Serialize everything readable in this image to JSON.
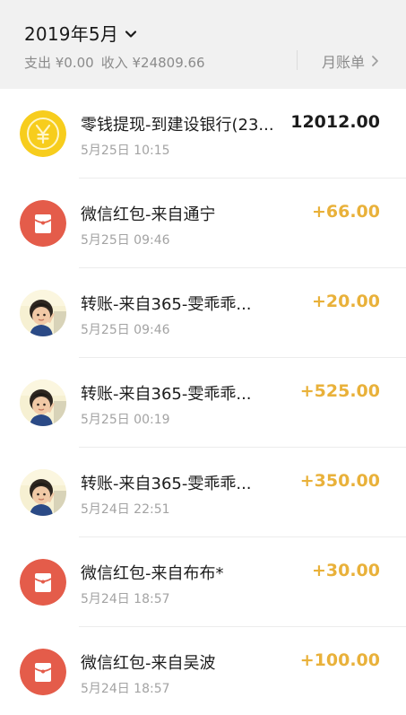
{
  "header": {
    "month": "2019年5月",
    "expense": "支出 ¥0.00",
    "income": "收入 ¥24809.66",
    "bill_link": "月账单"
  },
  "icons": {
    "coin": "yen-coin-icon",
    "red_packet": "red-packet-icon",
    "avatar": "child-avatar-photo"
  },
  "colors": {
    "coin": "#f7cd1d",
    "red_packet": "#e45c4a",
    "income_amount": "#e9b13a"
  },
  "transactions": [
    {
      "title": "零钱提现-到建设银行(23...",
      "time": "5月25日 10:15",
      "amount": "12012.00",
      "icon": "coin",
      "type": "withdrawal"
    },
    {
      "title": "微信红包-来自通宁",
      "time": "5月25日 09:46",
      "amount": "+66.00",
      "icon": "red_packet",
      "type": "income"
    },
    {
      "title": "转账-来自365-雯乖乖...",
      "time": "5月25日 09:46",
      "amount": "+20.00",
      "icon": "avatar",
      "type": "income"
    },
    {
      "title": "转账-来自365-雯乖乖...",
      "time": "5月25日 00:19",
      "amount": "+525.00",
      "icon": "avatar",
      "type": "income"
    },
    {
      "title": "转账-来自365-雯乖乖...",
      "time": "5月24日 22:51",
      "amount": "+350.00",
      "icon": "avatar",
      "type": "income"
    },
    {
      "title": "微信红包-来自布布*",
      "time": "5月24日 18:57",
      "amount": "+30.00",
      "icon": "red_packet",
      "type": "income"
    },
    {
      "title": "微信红包-来自吴波",
      "time": "5月24日 18:57",
      "amount": "+100.00",
      "icon": "red_packet",
      "type": "income"
    }
  ]
}
